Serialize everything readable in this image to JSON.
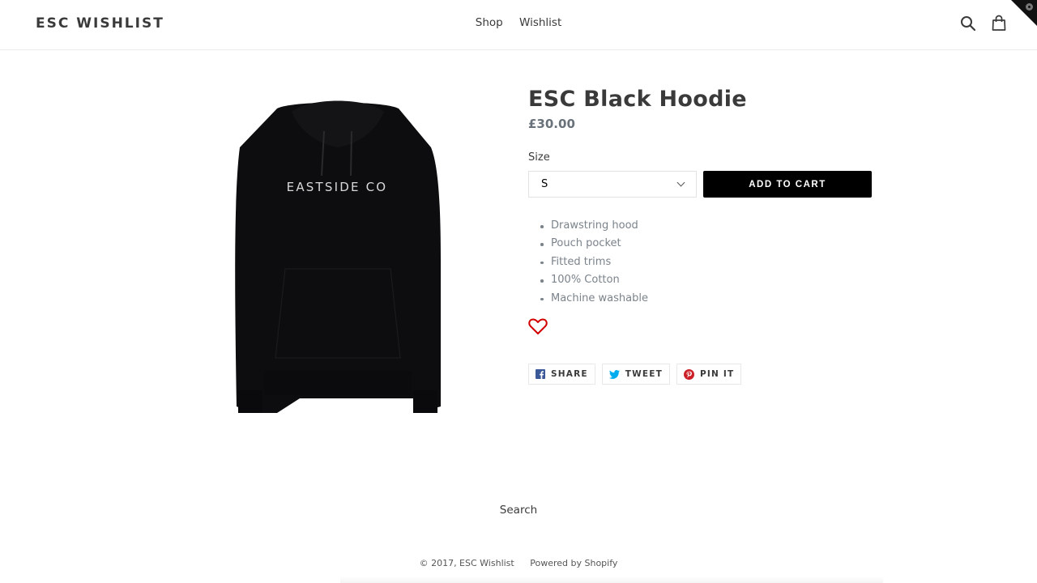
{
  "header": {
    "logo": "ESC WISHLIST",
    "nav": [
      {
        "label": "Shop"
      },
      {
        "label": "Wishlist"
      }
    ],
    "icons": {
      "search": "search-icon",
      "cart": "shopping-bag-icon"
    }
  },
  "product": {
    "image_alt": "ESC Black Hoodie",
    "image_print_text": "EASTSIDE CO",
    "title": "ESC Black Hoodie",
    "price": "£30.00",
    "size_label": "Size",
    "size_selected": "S",
    "add_to_cart": "ADD TO CART",
    "features": [
      "Drawstring hood",
      "Pouch pocket",
      "Fitted trims",
      "100% Cotton",
      "Machine washable"
    ],
    "wishlist_icon": "heart-outline-icon",
    "share": [
      {
        "label": "SHARE",
        "icon": "facebook-icon"
      },
      {
        "label": "TWEET",
        "icon": "twitter-icon"
      },
      {
        "label": "PIN IT",
        "icon": "pinterest-icon"
      }
    ]
  },
  "colors": {
    "accent": "#000000",
    "heart": "#d10000",
    "facebook": "#3b5998",
    "twitter": "#00aced",
    "pinterest": "#cb2027"
  },
  "footer": {
    "search_link": "Search",
    "copyright": "© 2017, ESC Wishlist",
    "powered_by": "Powered by Shopify"
  }
}
